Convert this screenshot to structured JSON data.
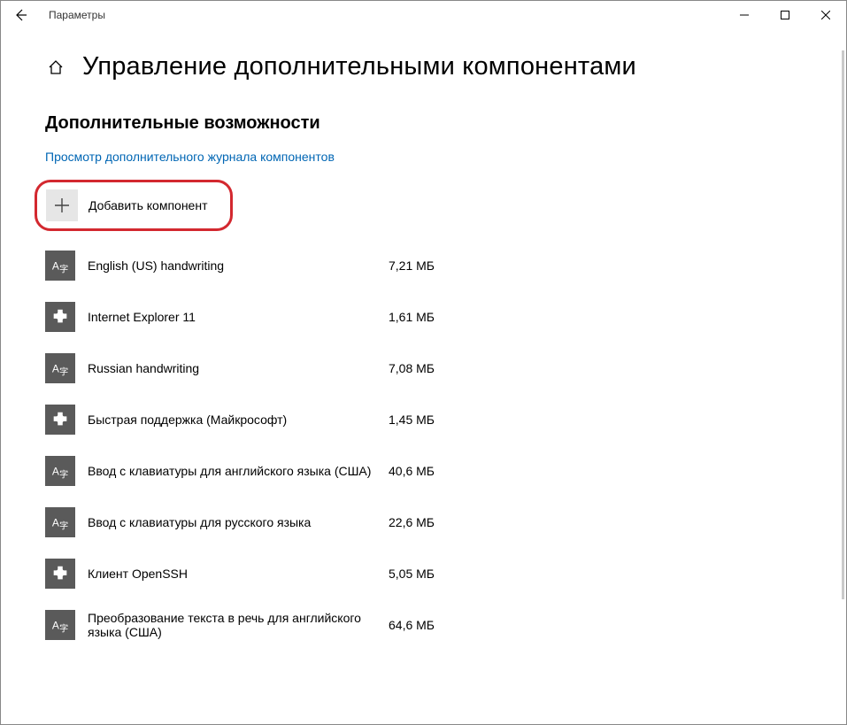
{
  "titlebar": {
    "title": "Параметры"
  },
  "header": {
    "page_title": "Управление дополнительными компонентами"
  },
  "section": {
    "title": "Дополнительные возможности"
  },
  "link": {
    "history": "Просмотр дополнительного журнала компонентов"
  },
  "add": {
    "label": "Добавить компонент"
  },
  "features": [
    {
      "icon": "font",
      "label": "English (US) handwriting",
      "size": "7,21 МБ"
    },
    {
      "icon": "plugin",
      "label": "Internet Explorer 11",
      "size": "1,61 МБ"
    },
    {
      "icon": "font",
      "label": "Russian handwriting",
      "size": "7,08 МБ"
    },
    {
      "icon": "plugin",
      "label": "Быстрая поддержка (Майкрософт)",
      "size": "1,45 МБ"
    },
    {
      "icon": "font",
      "label": "Ввод с клавиатуры для английского языка (США)",
      "size": "40,6 МБ"
    },
    {
      "icon": "font",
      "label": "Ввод с клавиатуры для русского языка",
      "size": "22,6 МБ"
    },
    {
      "icon": "plugin",
      "label": "Клиент OpenSSH",
      "size": "5,05 МБ"
    },
    {
      "icon": "font",
      "label": "Преобразование текста в речь для английского языка (США)",
      "size": "64,6 МБ"
    }
  ]
}
